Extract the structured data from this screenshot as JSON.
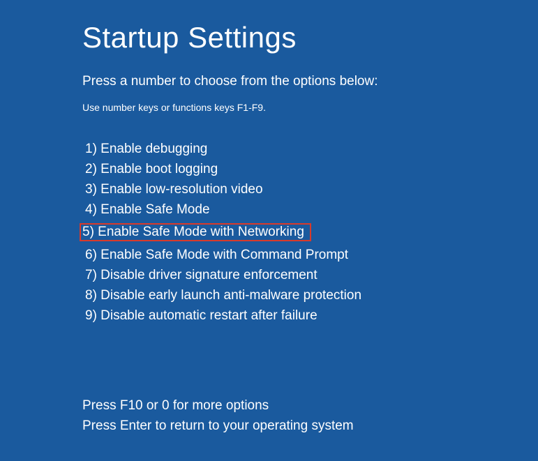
{
  "title": "Startup Settings",
  "subtitle": "Press a number to choose from the options below:",
  "hint": "Use number keys or functions keys F1-F9.",
  "options": [
    {
      "label": "1) Enable debugging",
      "highlighted": false
    },
    {
      "label": "2) Enable boot logging",
      "highlighted": false
    },
    {
      "label": "3) Enable low-resolution video",
      "highlighted": false
    },
    {
      "label": "4) Enable Safe Mode",
      "highlighted": false
    },
    {
      "label": "5) Enable Safe Mode with Networking",
      "highlighted": true
    },
    {
      "label": "6) Enable Safe Mode with Command Prompt",
      "highlighted": false
    },
    {
      "label": "7) Disable driver signature enforcement",
      "highlighted": false
    },
    {
      "label": "8) Disable early launch anti-malware protection",
      "highlighted": false
    },
    {
      "label": "9) Disable automatic restart after failure",
      "highlighted": false
    }
  ],
  "footer": {
    "line1": "Press F10 or 0 for more options",
    "line2": "Press Enter to return to your operating system"
  }
}
